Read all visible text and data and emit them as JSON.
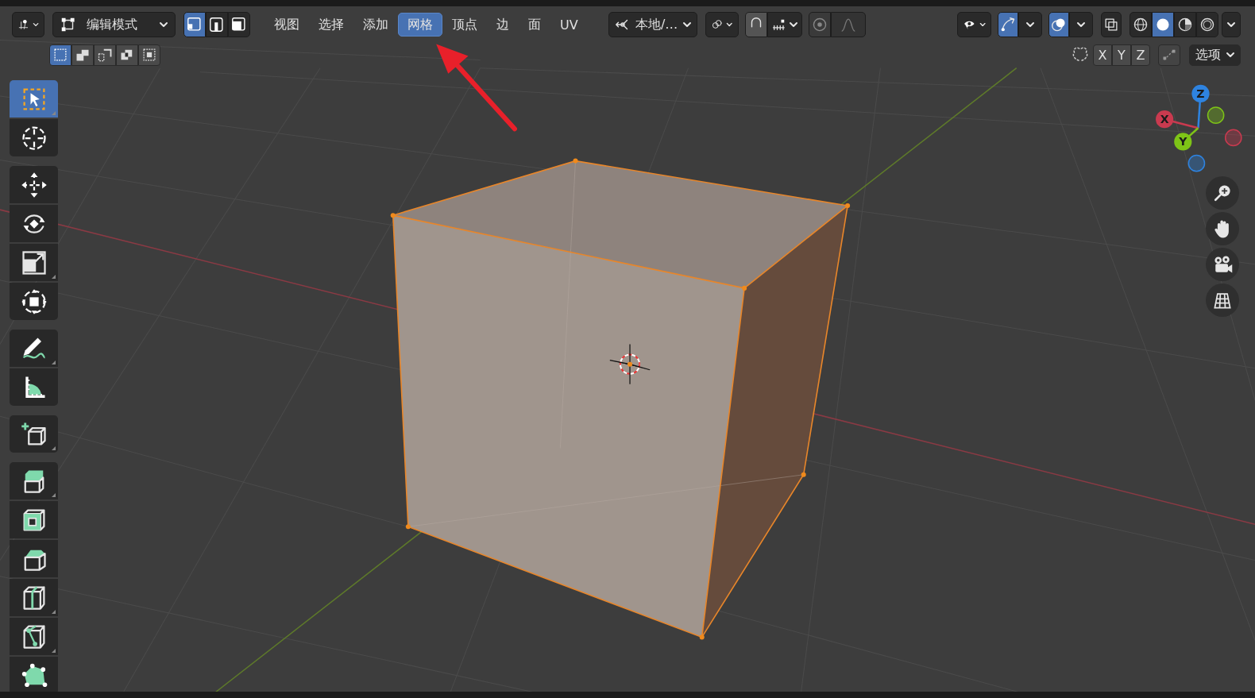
{
  "header": {
    "mode": {
      "label": "编辑模式"
    },
    "select_modes": [
      {
        "kind": "vertex",
        "selected": true
      },
      {
        "kind": "edge",
        "selected": false
      },
      {
        "kind": "face",
        "selected": false
      }
    ],
    "menus": [
      {
        "label": "视图",
        "selected": false
      },
      {
        "label": "选择",
        "selected": false
      },
      {
        "label": "添加",
        "selected": false
      },
      {
        "label": "网格",
        "selected": true
      },
      {
        "label": "顶点",
        "selected": false
      },
      {
        "label": "边",
        "selected": false
      },
      {
        "label": "面",
        "selected": false
      },
      {
        "label": "UV",
        "selected": false
      }
    ],
    "orientation": {
      "label": "本地/…"
    },
    "gizmos": {
      "on": true
    },
    "overlays": {
      "on": true
    },
    "xray": {
      "on": false
    },
    "shading_modes": [
      {
        "kind": "wireframe",
        "selected": false
      },
      {
        "kind": "solid",
        "selected": true
      },
      {
        "kind": "material",
        "selected": false
      },
      {
        "kind": "rendered",
        "selected": false
      }
    ]
  },
  "subheader": {
    "box_modes": [
      {
        "kind": "new",
        "selected": true
      },
      {
        "kind": "extend",
        "selected": false
      },
      {
        "kind": "subtract",
        "selected": false
      },
      {
        "kind": "difference",
        "selected": false
      },
      {
        "kind": "intersect",
        "selected": false
      }
    ],
    "axes": [
      {
        "label": "X"
      },
      {
        "label": "Y"
      },
      {
        "label": "Z"
      }
    ],
    "options": {
      "label": "选项"
    }
  },
  "toolbar": {
    "groups": [
      {
        "tools": [
          {
            "kind": "select_box",
            "selected": true
          },
          {
            "kind": "cursor",
            "selected": false
          }
        ]
      },
      {
        "tools": [
          {
            "kind": "move",
            "selected": false
          },
          {
            "kind": "rotate",
            "selected": false
          },
          {
            "kind": "scale",
            "selected": false
          },
          {
            "kind": "transform",
            "selected": false
          }
        ]
      },
      {
        "tools": [
          {
            "kind": "annotate",
            "selected": false
          },
          {
            "kind": "measure",
            "selected": false
          }
        ]
      },
      {
        "tools": [
          {
            "kind": "add_cube",
            "selected": false
          }
        ]
      },
      {
        "tools": [
          {
            "kind": "extrude",
            "selected": false
          },
          {
            "kind": "inset",
            "selected": false
          },
          {
            "kind": "bevel",
            "selected": false
          },
          {
            "kind": "loop_cut",
            "selected": false
          },
          {
            "kind": "knife",
            "selected": false
          },
          {
            "kind": "poly_build",
            "selected": false
          }
        ]
      }
    ]
  },
  "gizmo": {
    "axes": [
      {
        "label": "Z",
        "color": "#2e83e0"
      },
      {
        "label": "X",
        "color": "#c93a4f"
      },
      {
        "label": "Y",
        "color": "#7ec417"
      }
    ],
    "negative_axes": [
      {
        "color": "#7ec417"
      },
      {
        "color": "#c93a4f"
      },
      {
        "color": "#2e83e0"
      }
    ]
  },
  "nav_buttons": [
    {
      "kind": "zoom"
    },
    {
      "kind": "pan"
    },
    {
      "kind": "camera"
    },
    {
      "kind": "ortho"
    }
  ]
}
